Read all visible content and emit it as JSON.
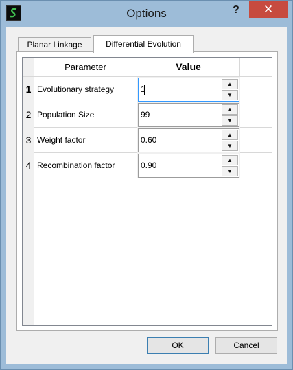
{
  "window": {
    "title": "Options",
    "help_glyph": "?",
    "close_glyph": "✕"
  },
  "tabs": [
    {
      "label": "Planar Linkage",
      "selected": false
    },
    {
      "label": "Differential Evolution",
      "selected": true
    }
  ],
  "table": {
    "headers": {
      "parameter": "Parameter",
      "value": "Value"
    },
    "rows": [
      {
        "index": "1",
        "parameter": "Evolutionary strategy",
        "value": "1"
      },
      {
        "index": "2",
        "parameter": "Population Size",
        "value": "99"
      },
      {
        "index": "3",
        "parameter": "Weight factor",
        "value": "0.60"
      },
      {
        "index": "4",
        "parameter": "Recombination factor",
        "value": "0.90"
      }
    ],
    "spin_up_glyph": "▲",
    "spin_down_glyph": "▼"
  },
  "buttons": {
    "ok": "OK",
    "cancel": "Cancel"
  },
  "colors": {
    "titlebar": "#9dbcd8",
    "close": "#c74b3f",
    "focus": "#3399ff"
  },
  "icons": {
    "app": "app-logo-icon",
    "help": "help-icon",
    "close": "close-icon",
    "up": "spin-up-arrow-icon",
    "down": "spin-down-arrow-icon"
  }
}
